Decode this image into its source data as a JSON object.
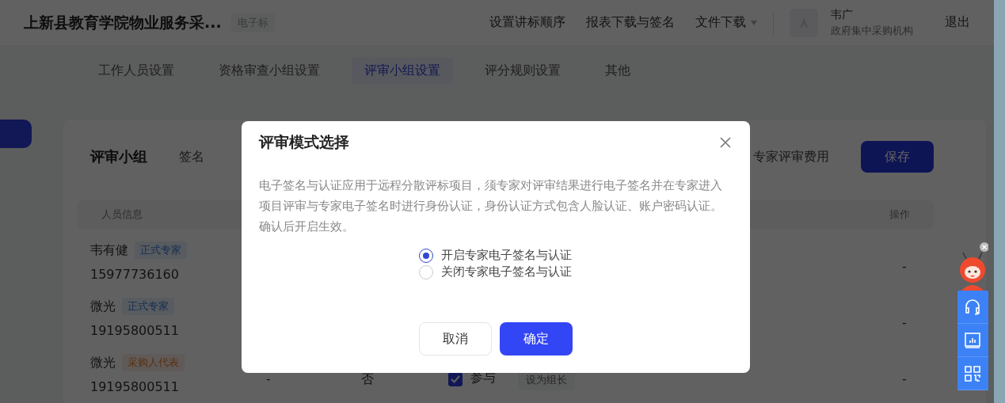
{
  "header": {
    "title": "上新县教育学院物业服务采...",
    "tag": "电子标",
    "nav": [
      {
        "label": "设置讲标顺序",
        "kind": "link"
      },
      {
        "label": "报表下载与签名",
        "kind": "link"
      },
      {
        "label": "文件下载",
        "kind": "dropdown"
      }
    ],
    "user": {
      "name": "韦广",
      "org": "政府集中采购机构"
    },
    "logout": "退出"
  },
  "tabs": [
    {
      "label": "工作人员设置",
      "selected": false
    },
    {
      "label": "资格审查小组设置",
      "selected": false
    },
    {
      "label": "评审小组设置",
      "selected": true
    },
    {
      "label": "评分规则设置",
      "selected": false
    },
    {
      "label": "其他",
      "selected": false
    }
  ],
  "panel": {
    "title": "评审小组",
    "links": [
      "签名",
      "专家评审费用"
    ],
    "save": "保存",
    "table": {
      "columns": [
        "人员信息",
        "操作"
      ],
      "rows": [
        {
          "name": "韦有健",
          "tag": "正式专家",
          "kind": "expert",
          "phone": "15977736160",
          "action": "-"
        },
        {
          "name": "微光",
          "tag": "正式专家",
          "kind": "expert",
          "phone": "19195800511",
          "action": "-"
        },
        {
          "name": "微光",
          "tag": "采购人代表",
          "kind": "buyer",
          "phone": "19195800511",
          "column_2": "-",
          "column_3": "否",
          "participate": {
            "label": "参与",
            "checked": true
          },
          "lead_button": "设为组长",
          "action": "-"
        }
      ]
    }
  },
  "dialog": {
    "title": "评审模式选择",
    "text": "电子签名与认证应用于远程分散评标项目，须专家对评审结果进行电子签名并在专家进入项目评审与专家电子签名时进行身份认证，身份认证方式包含人脸认证、账户密码认证。确认后开启生效。",
    "options": [
      {
        "label": "开启专家电子签名与认证",
        "selected": true
      },
      {
        "label": "关闭专家电子签名与认证",
        "selected": false
      }
    ],
    "cancel": "取消",
    "confirm": "确定"
  }
}
